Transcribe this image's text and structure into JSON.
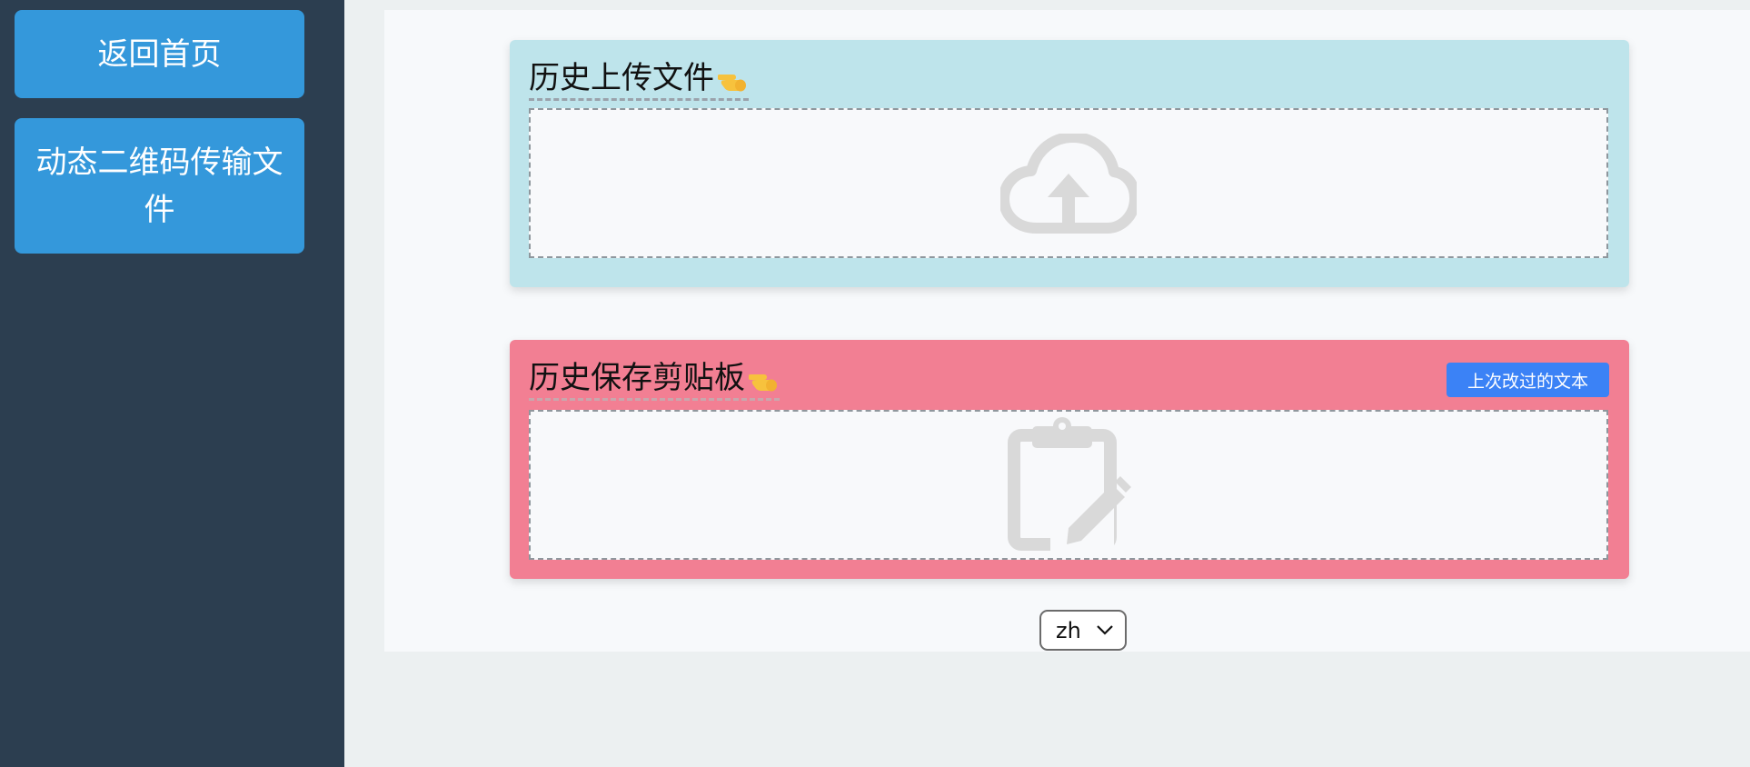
{
  "sidebar": {
    "home_button": "返回首页",
    "qr_button": "动态二维码传输文件"
  },
  "upload_card": {
    "title": "历史上传文件",
    "background": "#bee4eb",
    "dropzone_icon": "cloud-upload-icon"
  },
  "clipboard_card": {
    "title": "历史保存剪贴板",
    "background": "#f27f93",
    "last_text_button": "上次改过的文本",
    "dropzone_icon": "clipboard-edit-icon"
  },
  "language_select": {
    "value": "zh"
  },
  "colors": {
    "sidebar": "#2c3e50",
    "nav_button": "#3498db",
    "accent_button": "#3b82f6"
  }
}
